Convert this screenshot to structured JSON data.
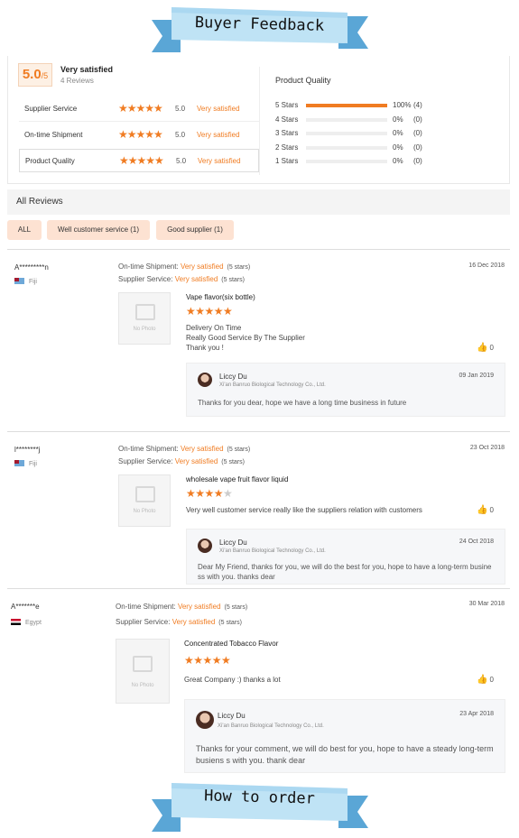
{
  "banners": {
    "top": "Buyer Feedback",
    "bottom": "How to order"
  },
  "summary": {
    "score": "5.0",
    "score_suffix": "/5",
    "overall_label": "Very satisfied",
    "review_count": "4 Reviews",
    "dimensions": [
      {
        "name": "Supplier Service",
        "score": "5.0",
        "text": "Very satisfied",
        "stars": "★★★★★"
      },
      {
        "name": "On-time Shipment",
        "score": "5.0",
        "text": "Very satisfied",
        "stars": "★★★★★"
      },
      {
        "name": "Product Quality",
        "score": "5.0",
        "text": "Very satisfied",
        "stars": "★★★★★"
      }
    ],
    "distribution_title": "Product Quality",
    "distribution": [
      {
        "label": "5 Stars",
        "percent": "100%",
        "count": "(4)",
        "fraction": 1.0
      },
      {
        "label": "4 Stars",
        "percent": "0%",
        "count": "(0)",
        "fraction": 0
      },
      {
        "label": "3 Stars",
        "percent": "0%",
        "count": "(0)",
        "fraction": 0
      },
      {
        "label": "2 Stars",
        "percent": "0%",
        "count": "(0)",
        "fraction": 0
      },
      {
        "label": "1 Stars",
        "percent": "0%",
        "count": "(0)",
        "fraction": 0
      }
    ]
  },
  "all_reviews_label": "All Reviews",
  "filters": [
    "ALL",
    "Well customer service (1)",
    "Good supplier (1)"
  ],
  "shipment_label": "On-time Shipment:",
  "service_label": "Supplier Service:",
  "reviews": [
    {
      "name": "A*********n",
      "country": "Fiji",
      "shipment": "Very satisfied",
      "shipment_count": "(5 stars)",
      "service": "Very satisfied",
      "service_count": "(5 stars)",
      "date": "16 Dec 2018",
      "product": "Vape flavor(six bottle)",
      "stars_on": "★★★★★",
      "stars_off": "",
      "text": "Delivery On Time\nReally Good Service By The Supplier\nThank you !",
      "likes": "0",
      "no_photo": "No Photo",
      "reply": {
        "name": "Liccy Du",
        "company": "Xi'an Banruo Biological Technology Co., Ltd.",
        "date": "09 Jan 2019",
        "text": "Thanks for you dear, hope we have a long time business in future"
      }
    },
    {
      "name": "l********j",
      "country": "Fiji",
      "shipment": "Very satisfied",
      "shipment_count": "(5 stars)",
      "service": "Very satisfied",
      "service_count": "(5 stars)",
      "date": "23 Oct 2018",
      "product": "wholesale vape fruit flavor liquid",
      "stars_on": "★★★★",
      "stars_off": "★",
      "text": "Very well customer service really like the suppliers relation with customers",
      "likes": "0",
      "no_photo": "No Photo",
      "reply": {
        "name": "Liccy Du",
        "company": "Xi'an Banruo Biological Technology Co., Ltd.",
        "date": "24 Oct 2018",
        "text": "Dear My Friend, thanks for you, we will do the best for you, hope to have a long-term busine ss with you. thanks dear"
      }
    },
    {
      "name": "A*******e",
      "country": "Egypt",
      "shipment": "Very satisfied",
      "shipment_count": "(5 stars)",
      "service": "Very satisfied",
      "service_count": "(5 stars)",
      "date": "30 Mar 2018",
      "product": "Concentrated Tobacco Flavor",
      "stars_on": "★★★★★",
      "stars_off": "",
      "text": "Great Company :) thanks a lot",
      "likes": "0",
      "no_photo": "No Photo",
      "reply": {
        "name": "Liccy Du",
        "company": "Xi'an Banruo Biological Technology Co., Ltd.",
        "date": "23 Apr 2018",
        "text": "Thanks for your comment, we will do best for you, hope to have a steady long-term busiens s with you. thank dear"
      }
    }
  ]
}
